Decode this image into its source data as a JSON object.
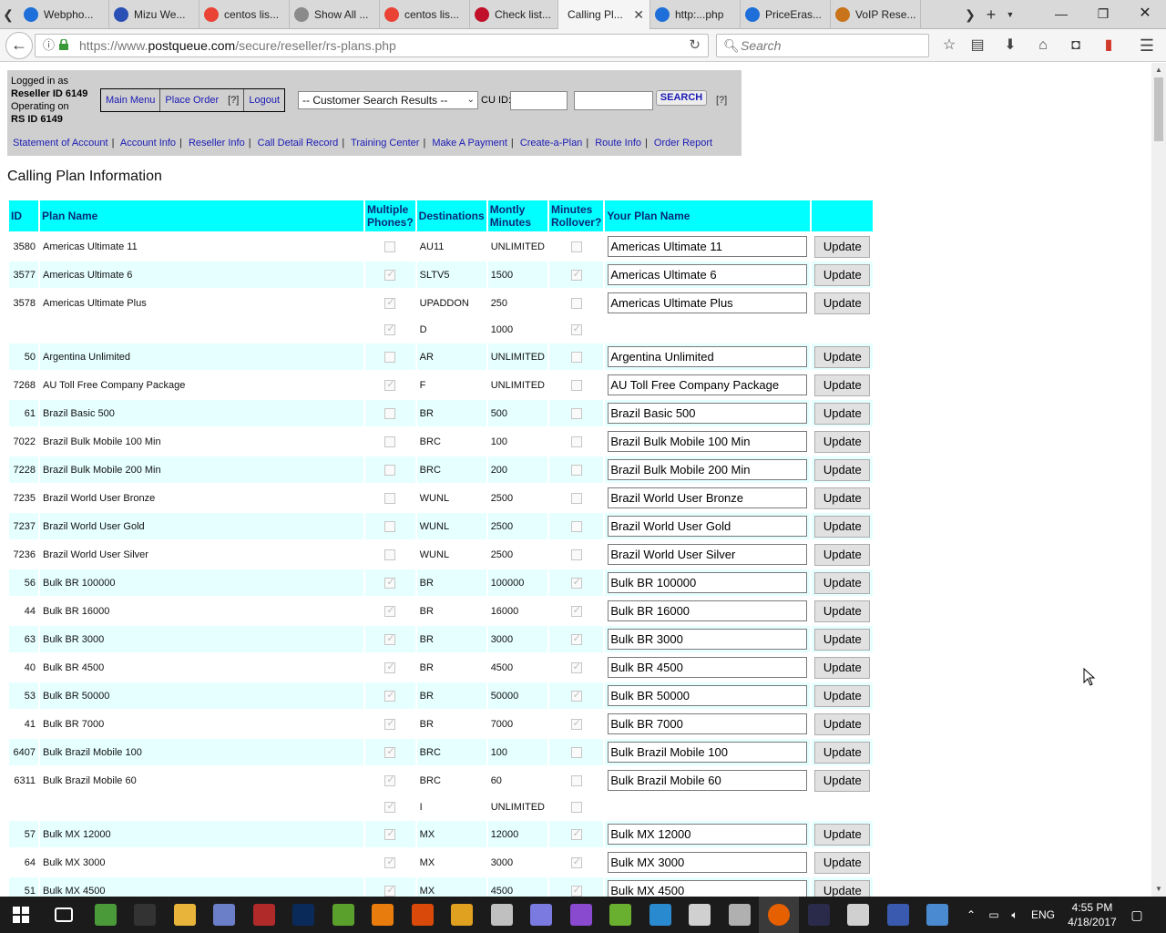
{
  "browser": {
    "tabs": [
      {
        "label": "Webpho...",
        "color": "#1e6fd9"
      },
      {
        "label": "Mizu We...",
        "color": "#2a4fb5"
      },
      {
        "label": "centos lis...",
        "color": "#ea4335"
      },
      {
        "label": "Show All ...",
        "color": "#8a8a8a"
      },
      {
        "label": "centos lis...",
        "color": "#ea4335"
      },
      {
        "label": "Check list...",
        "color": "#c0102a"
      },
      {
        "label": "Calling Pl...",
        "color": "#f5f5f5"
      },
      {
        "label": "http:...php",
        "color": "#1e6fd9"
      },
      {
        "label": "PriceEras...",
        "color": "#1e6fd9"
      },
      {
        "label": "VoIP Rese...",
        "color": "#c9731a"
      }
    ],
    "active_tab_index": 6,
    "url_prefix": "https://www.",
    "url_host": "postqueue.com",
    "url_path": "/secure/reseller/rs-plans.php",
    "search_placeholder": "Search"
  },
  "panel": {
    "login_line1": "Logged in as",
    "login_line2": "Reseller ID 6149",
    "login_line3": "Operating on",
    "login_line4": "RS ID 6149",
    "top_menu": [
      "Main Menu",
      "Place Order",
      "[?]",
      "Logout"
    ],
    "customer_select": "-- Customer Search Results --",
    "cuid_label": "CU ID:",
    "search_button": "SEARCH",
    "help": "[?]",
    "sub_menu": [
      "Statement of Account",
      "Account Info",
      "Reseller Info",
      "Call Detail Record",
      "Training Center",
      "Make A Payment",
      "Create-a-Plan",
      "Route Info",
      "Order Report"
    ]
  },
  "page": {
    "heading": "Calling Plan Information"
  },
  "table": {
    "headers": [
      "ID",
      "Plan Name",
      "Multiple Phones?",
      "Destinations",
      "Montly Minutes",
      "Minutes Rollover?",
      "Your Plan Name",
      ""
    ],
    "rows": [
      {
        "id": "3580",
        "name": "Americas Ultimate 11",
        "multi": false,
        "dest": "AU11",
        "minutes": "UNLIMITED",
        "rollover": false,
        "plan_name": "Americas Ultimate 11",
        "button": "Update",
        "sub": false,
        "alt": false
      },
      {
        "id": "3577",
        "name": "Americas Ultimate 6",
        "multi": true,
        "dest": "SLTV5",
        "minutes": "1500",
        "rollover": true,
        "plan_name": "Americas Ultimate 6",
        "button": "Update",
        "sub": false,
        "alt": true
      },
      {
        "id": "3578",
        "name": "Americas Ultimate Plus",
        "multi": true,
        "dest": "UPADDON",
        "minutes": "250",
        "rollover": false,
        "plan_name": "Americas Ultimate Plus",
        "button": "Update",
        "sub": false,
        "alt": false
      },
      {
        "id": "",
        "name": "",
        "multi": true,
        "dest": "D",
        "minutes": "1000",
        "rollover": true,
        "plan_name": "",
        "button": "",
        "sub": true,
        "alt": false
      },
      {
        "id": "50",
        "name": "Argentina Unlimited",
        "multi": false,
        "dest": "AR",
        "minutes": "UNLIMITED",
        "rollover": false,
        "plan_name": "Argentina Unlimited",
        "button": "Update",
        "sub": false,
        "alt": true
      },
      {
        "id": "7268",
        "name": "AU Toll Free Company Package",
        "multi": true,
        "dest": "F",
        "minutes": "UNLIMITED",
        "rollover": false,
        "plan_name": "AU Toll Free Company Package",
        "button": "Update",
        "sub": false,
        "alt": false
      },
      {
        "id": "61",
        "name": "Brazil Basic 500",
        "multi": false,
        "dest": "BR",
        "minutes": "500",
        "rollover": false,
        "plan_name": "Brazil Basic 500",
        "button": "Update",
        "sub": false,
        "alt": true
      },
      {
        "id": "7022",
        "name": "Brazil Bulk Mobile 100 Min",
        "multi": false,
        "dest": "BRC",
        "minutes": "100",
        "rollover": false,
        "plan_name": "Brazil Bulk Mobile 100 Min",
        "button": "Update",
        "sub": false,
        "alt": false
      },
      {
        "id": "7228",
        "name": "Brazil Bulk Mobile 200 Min",
        "multi": false,
        "dest": "BRC",
        "minutes": "200",
        "rollover": false,
        "plan_name": "Brazil Bulk Mobile 200 Min",
        "button": "Update",
        "sub": false,
        "alt": true
      },
      {
        "id": "7235",
        "name": "Brazil World User Bronze",
        "multi": false,
        "dest": "WUNL",
        "minutes": "2500",
        "rollover": false,
        "plan_name": "Brazil World User Bronze",
        "button": "Update",
        "sub": false,
        "alt": false
      },
      {
        "id": "7237",
        "name": "Brazil World User Gold",
        "multi": false,
        "dest": "WUNL",
        "minutes": "2500",
        "rollover": false,
        "plan_name": "Brazil World User Gold",
        "button": "Update",
        "sub": false,
        "alt": true
      },
      {
        "id": "7236",
        "name": "Brazil World User Silver",
        "multi": false,
        "dest": "WUNL",
        "minutes": "2500",
        "rollover": false,
        "plan_name": "Brazil World User Silver",
        "button": "Update",
        "sub": false,
        "alt": false
      },
      {
        "id": "56",
        "name": "Bulk BR 100000",
        "multi": true,
        "dest": "BR",
        "minutes": "100000",
        "rollover": true,
        "plan_name": "Bulk BR 100000",
        "button": "Update",
        "sub": false,
        "alt": true
      },
      {
        "id": "44",
        "name": "Bulk BR 16000",
        "multi": true,
        "dest": "BR",
        "minutes": "16000",
        "rollover": true,
        "plan_name": "Bulk BR 16000",
        "button": "Update",
        "sub": false,
        "alt": false
      },
      {
        "id": "63",
        "name": "Bulk BR 3000",
        "multi": true,
        "dest": "BR",
        "minutes": "3000",
        "rollover": true,
        "plan_name": "Bulk BR 3000",
        "button": "Update",
        "sub": false,
        "alt": true
      },
      {
        "id": "40",
        "name": "Bulk BR 4500",
        "multi": true,
        "dest": "BR",
        "minutes": "4500",
        "rollover": true,
        "plan_name": "Bulk BR 4500",
        "button": "Update",
        "sub": false,
        "alt": false
      },
      {
        "id": "53",
        "name": "Bulk BR 50000",
        "multi": true,
        "dest": "BR",
        "minutes": "50000",
        "rollover": true,
        "plan_name": "Bulk BR 50000",
        "button": "Update",
        "sub": false,
        "alt": true
      },
      {
        "id": "41",
        "name": "Bulk BR 7000",
        "multi": true,
        "dest": "BR",
        "minutes": "7000",
        "rollover": true,
        "plan_name": "Bulk BR 7000",
        "button": "Update",
        "sub": false,
        "alt": false
      },
      {
        "id": "6407",
        "name": "Bulk Brazil Mobile 100",
        "multi": true,
        "dest": "BRC",
        "minutes": "100",
        "rollover": false,
        "plan_name": "Bulk Brazil Mobile 100",
        "button": "Update",
        "sub": false,
        "alt": true
      },
      {
        "id": "6311",
        "name": "Bulk Brazil Mobile 60",
        "multi": true,
        "dest": "BRC",
        "minutes": "60",
        "rollover": false,
        "plan_name": "Bulk Brazil Mobile 60",
        "button": "Update",
        "sub": false,
        "alt": false
      },
      {
        "id": "",
        "name": "",
        "multi": true,
        "dest": "I",
        "minutes": "UNLIMITED",
        "rollover": false,
        "plan_name": "",
        "button": "",
        "sub": true,
        "alt": false
      },
      {
        "id": "57",
        "name": "Bulk MX 12000",
        "multi": true,
        "dest": "MX",
        "minutes": "12000",
        "rollover": true,
        "plan_name": "Bulk MX 12000",
        "button": "Update",
        "sub": false,
        "alt": true
      },
      {
        "id": "64",
        "name": "Bulk MX 3000",
        "multi": true,
        "dest": "MX",
        "minutes": "3000",
        "rollover": true,
        "plan_name": "Bulk MX 3000",
        "button": "Update",
        "sub": false,
        "alt": false
      },
      {
        "id": "51",
        "name": "Bulk MX 4500",
        "multi": true,
        "dest": "MX",
        "minutes": "4500",
        "rollover": true,
        "plan_name": "Bulk MX 4500",
        "button": "Update",
        "sub": false,
        "alt": true
      }
    ]
  },
  "taskbar": {
    "language": "ENG",
    "time": "4:55 PM",
    "date": "4/18/2017",
    "apps": [
      {
        "name": "task-view-icon",
        "color": "#1b1b1b"
      },
      {
        "name": "chrome-icon",
        "color": "#4a9a3a"
      },
      {
        "name": "terminal-icon",
        "color": "#333333"
      },
      {
        "name": "file-explorer-icon",
        "color": "#e8b53a"
      },
      {
        "name": "app-puzzle-icon",
        "color": "#6a7fc8"
      },
      {
        "name": "archive-icon",
        "color": "#b02a2a"
      },
      {
        "name": "photoshop-icon",
        "color": "#0a2a5a"
      },
      {
        "name": "notepad-plus-icon",
        "color": "#5aa02c"
      },
      {
        "name": "blender-icon",
        "color": "#e87d0d"
      },
      {
        "name": "fire-app-icon",
        "color": "#d94a0a"
      },
      {
        "name": "sun-app-icon",
        "color": "#e0a020"
      },
      {
        "name": "tools-icon",
        "color": "#c0c0c0"
      },
      {
        "name": "infinity-icon",
        "color": "#7a7ae0"
      },
      {
        "name": "visual-studio-icon",
        "color": "#8a4ad0"
      },
      {
        "name": "green-app-icon",
        "color": "#6ab030"
      },
      {
        "name": "globe-app-icon",
        "color": "#2a8ad0"
      },
      {
        "name": "calendar-app-icon",
        "color": "#d0d0d0"
      },
      {
        "name": "office-app-icon",
        "color": "#b0b0b0"
      },
      {
        "name": "firefox-icon",
        "color": "#e66000"
      },
      {
        "name": "r-app-icon",
        "color": "#2a2a4a"
      },
      {
        "name": "document-icon",
        "color": "#d0d0d0"
      },
      {
        "name": "pdf-icon",
        "color": "#3a5ab0"
      },
      {
        "name": "security-app-icon",
        "color": "#4a8ad0"
      }
    ]
  }
}
